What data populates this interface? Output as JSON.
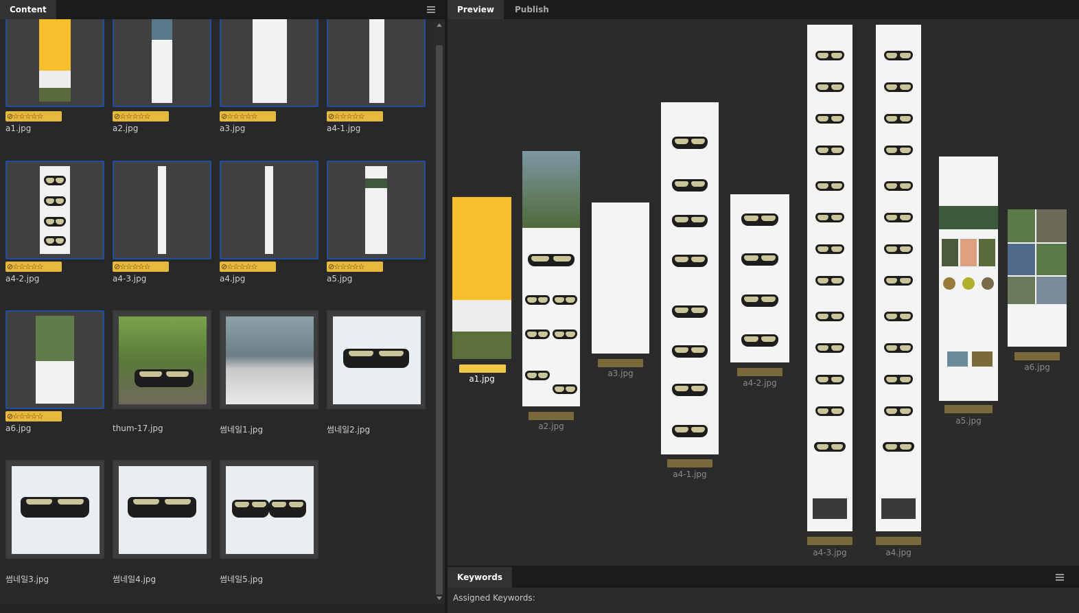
{
  "content_panel": {
    "tab_label": "Content",
    "menu_icon": "hamburger-menu-icon"
  },
  "preview_panel": {
    "tabs": [
      "Preview",
      "Publish"
    ]
  },
  "keywords_panel": {
    "tab_label": "Keywords",
    "assigned_label": "Assigned Keywords:",
    "menu_icon": "hamburger-menu-icon"
  },
  "rating_glyph": "⊘☆☆☆☆☆",
  "grid": [
    {
      "name": "a1.jpg",
      "rated": true,
      "selected": true
    },
    {
      "name": "a2.jpg",
      "rated": true,
      "selected": true
    },
    {
      "name": "a3.jpg",
      "rated": true,
      "selected": true
    },
    {
      "name": "a4-1.jpg",
      "rated": true,
      "selected": true
    },
    {
      "name": "a4-2.jpg",
      "rated": true,
      "selected": true
    },
    {
      "name": "a4-3.jpg",
      "rated": true,
      "selected": true
    },
    {
      "name": "a4.jpg",
      "rated": true,
      "selected": true
    },
    {
      "name": "a5.jpg",
      "rated": true,
      "selected": true
    },
    {
      "name": "a6.jpg",
      "rated": true,
      "selected": true
    },
    {
      "name": "thum-17.jpg",
      "rated": false,
      "selected": false
    },
    {
      "name": "썸네일1.jpg",
      "rated": false,
      "selected": false
    },
    {
      "name": "썸네일2.jpg",
      "rated": false,
      "selected": false
    },
    {
      "name": "썸네일3.jpg",
      "rated": false,
      "selected": false
    },
    {
      "name": "썸네일4.jpg",
      "rated": false,
      "selected": false
    },
    {
      "name": "썸네일5.jpg",
      "rated": false,
      "selected": false
    }
  ],
  "preview": [
    {
      "name": "a1.jpg",
      "primary": true
    },
    {
      "name": "a2.jpg",
      "primary": false
    },
    {
      "name": "a3.jpg",
      "primary": false
    },
    {
      "name": "a4-1.jpg",
      "primary": false
    },
    {
      "name": "a4-2.jpg",
      "primary": false
    },
    {
      "name": "a4-3.jpg",
      "primary": false
    },
    {
      "name": "a4.jpg",
      "primary": false
    },
    {
      "name": "a5.jpg",
      "primary": false
    },
    {
      "name": "a6.jpg",
      "primary": false
    }
  ],
  "colors": {
    "selection_border": "#1f4ea6",
    "rating_badge": "#e6b93e",
    "primary_label_bar": "#f1c84a",
    "label_bar": "#7a6a3b"
  }
}
